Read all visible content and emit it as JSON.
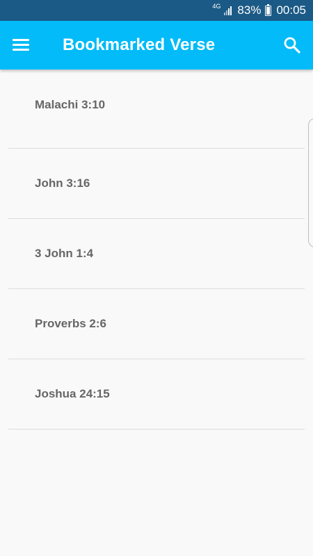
{
  "status_bar": {
    "network_type": "4G",
    "battery_percent": "83%",
    "battery_level": 0.83,
    "time": "00:05",
    "background_color": "#1b5a86"
  },
  "app_bar": {
    "title": "Bookmarked Verse",
    "menu_icon": "hamburger-menu-icon",
    "search_icon": "search-icon",
    "background_color": "#02bbf8"
  },
  "bookmarks": [
    {
      "label": "Malachi 3:10"
    },
    {
      "label": "John 3:16"
    },
    {
      "label": "3 John 1:4"
    },
    {
      "label": "Proverbs 2:6"
    },
    {
      "label": "Joshua 24:15"
    }
  ],
  "colors": {
    "background": "#f9f9f9",
    "divider": "#dcdcdc",
    "item_text": "#666666"
  }
}
